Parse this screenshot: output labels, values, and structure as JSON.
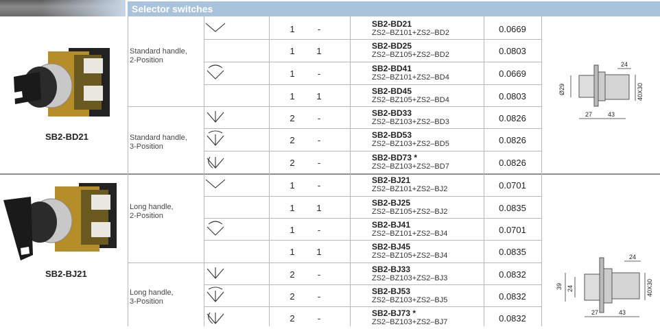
{
  "header": {
    "title": "Selector switches"
  },
  "products": [
    {
      "label": "SB2-BD21"
    },
    {
      "label": "SB2-BJ21"
    }
  ],
  "groups": [
    {
      "line1": "Standard handle,",
      "line2": "2-Position"
    },
    {
      "line1": "Standard handle,",
      "line2": "3-Position"
    },
    {
      "line1": "Long handle,",
      "line2": "2-Position"
    },
    {
      "line1": "Long handle,",
      "line2": "3-Position"
    }
  ],
  "rows": [
    {
      "no": "1",
      "nc": "-",
      "model": "SB2-BD21",
      "parts": "ZS2–BZ101+ZS2–BD2",
      "weight": "0.0669"
    },
    {
      "no": "1",
      "nc": "1",
      "model": "SB2-BD25",
      "parts": "ZS2–BZ105+ZS2–BD2",
      "weight": "0.0803"
    },
    {
      "no": "1",
      "nc": "-",
      "model": "SB2-BD41",
      "parts": "ZS2–BZ101+ZS2–BD4",
      "weight": "0.0669"
    },
    {
      "no": "1",
      "nc": "1",
      "model": "SB2-BD45",
      "parts": "ZS2–BZ105+ZS2–BD4",
      "weight": "0.0803"
    },
    {
      "no": "2",
      "nc": "-",
      "model": "SB2-BD33",
      "parts": "ZS2–BZ103+ZS2–BD3",
      "weight": "0.0826"
    },
    {
      "no": "2",
      "nc": "-",
      "model": "SB2-BD53",
      "parts": "ZS2–BZ103+ZS2–BD5",
      "weight": "0.0826"
    },
    {
      "no": "2",
      "nc": "-",
      "model": "SB2-BD73 *",
      "parts": "ZS2–BZ103+ZS2–BD7",
      "weight": "0.0826"
    },
    {
      "no": "1",
      "nc": "-",
      "model": "SB2-BJ21",
      "parts": "ZS2–BZ101+ZS2–BJ2",
      "weight": "0.0701"
    },
    {
      "no": "1",
      "nc": "1",
      "model": "SB2-BJ25",
      "parts": "ZS2–BZ105+ZS2–BJ2",
      "weight": "0.0835"
    },
    {
      "no": "1",
      "nc": "-",
      "model": "SB2-BJ41",
      "parts": "ZS2–BZ101+ZS2–BJ4",
      "weight": "0.0701"
    },
    {
      "no": "1",
      "nc": "1",
      "model": "SB2-BJ45",
      "parts": "ZS2–BZ105+ZS2–BJ4",
      "weight": "0.0835"
    },
    {
      "no": "2",
      "nc": "-",
      "model": "SB2-BJ33",
      "parts": "ZS2–BZ103+ZS2–BJ3",
      "weight": "0.0832"
    },
    {
      "no": "2",
      "nc": "-",
      "model": "SB2-BJ53",
      "parts": "ZS2–BZ103+ZS2–BJ5",
      "weight": "0.0832"
    },
    {
      "no": "2",
      "nc": "-",
      "model": "SB2-BJ73 *",
      "parts": "ZS2–BZ103+ZS2–BJ7",
      "weight": "0.0832"
    }
  ],
  "symbols": [
    "v-2pos",
    "arc-2pos",
    "v-3pos",
    "arc-3pos",
    "arc-3pos-left",
    "v-2pos",
    "arc-2pos",
    "v-3pos",
    "arc-3pos",
    "arc-3pos-left"
  ],
  "dimensions": {
    "top": {
      "d24": "24",
      "d29": "Ø29",
      "d40": "40X30",
      "d27": "27",
      "d43": "43"
    },
    "bottom": {
      "d24": "24",
      "d39": "39",
      "d24b": "24",
      "d40": "40X30",
      "d27": "27",
      "d43": "43"
    }
  }
}
